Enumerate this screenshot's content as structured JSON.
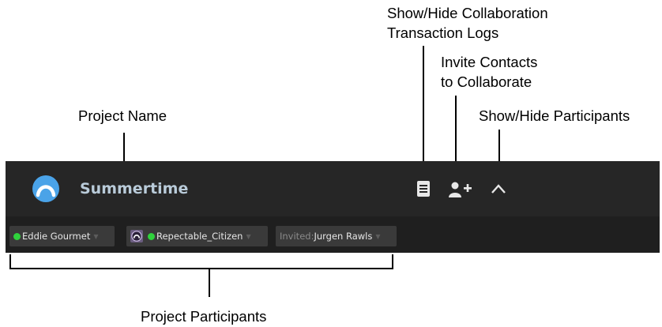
{
  "callouts": {
    "logs": [
      "Show/Hide Collaboration",
      "Transaction Logs"
    ],
    "invite": [
      "Invite Contacts",
      "to Collaborate"
    ],
    "participants_toggle": "Show/Hide Participants",
    "project_name": "Project Name",
    "project_participants": "Project Participants"
  },
  "toolbar": {
    "project_name": "Summertime",
    "icons": [
      "transaction-log-icon",
      "invite-contact-icon",
      "chevron-up-icon"
    ]
  },
  "participants": [
    {
      "name": "Eddie Gourmet",
      "status": "online"
    },
    {
      "name": "Repectable_Citizen",
      "status": "online",
      "avatar": "avatar-icon"
    },
    {
      "prefix": "Invited:",
      "name": "Jurgen Rawls",
      "status": "invited"
    }
  ],
  "colors": {
    "panel": "#262626",
    "participants_bar": "#1f1f1f",
    "online": "#2fd23c",
    "logo": "#4aa3e8"
  }
}
